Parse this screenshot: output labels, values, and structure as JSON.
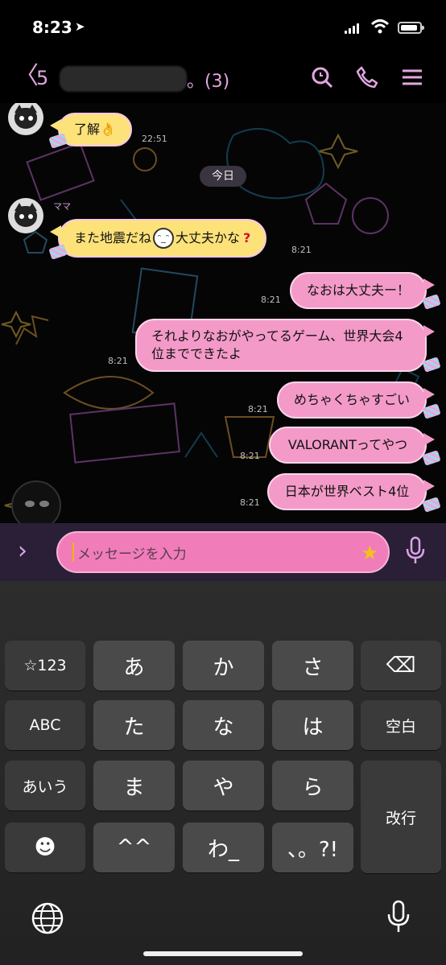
{
  "status_bar": {
    "time": "8:23"
  },
  "header": {
    "unread_count": "5",
    "title_suffix": "。(3)"
  },
  "chat": {
    "messages": [
      {
        "text": "了解👌",
        "time": "22:51"
      },
      {
        "date_chip": "今日"
      },
      {
        "sender": "ママ",
        "text_before": "また地震だね",
        "text_after": "大丈夫かな",
        "time": "8:21"
      },
      {
        "text": "なおは大丈夫ー！",
        "time": "8:21"
      },
      {
        "text": "それよりなおがやってるゲーム、世界大会4位までできたよ",
        "time": "8:21"
      },
      {
        "text": "めちゃくちゃすごい",
        "time": "8:21"
      },
      {
        "text": "VALORANTってやつ",
        "time": "8:21"
      },
      {
        "text": "日本が世界ベスト4位",
        "time": "8:21"
      }
    ]
  },
  "input": {
    "placeholder": "メッセージを入力"
  },
  "keyboard": {
    "rows": [
      [
        "☆123",
        "あ",
        "か",
        "さ",
        "⌫"
      ],
      [
        "ABC",
        "た",
        "な",
        "は",
        "空白"
      ],
      [
        "あいう",
        "ま",
        "や",
        "ら",
        "改行"
      ],
      [
        "☻",
        "^^",
        "わ_",
        "、。?!"
      ]
    ]
  },
  "colors": {
    "accent": "#e3a6e0",
    "incoming_bubble": "#fde27a",
    "outgoing_bubble": "#f39ac8",
    "input_bar": "#2a1f36"
  }
}
